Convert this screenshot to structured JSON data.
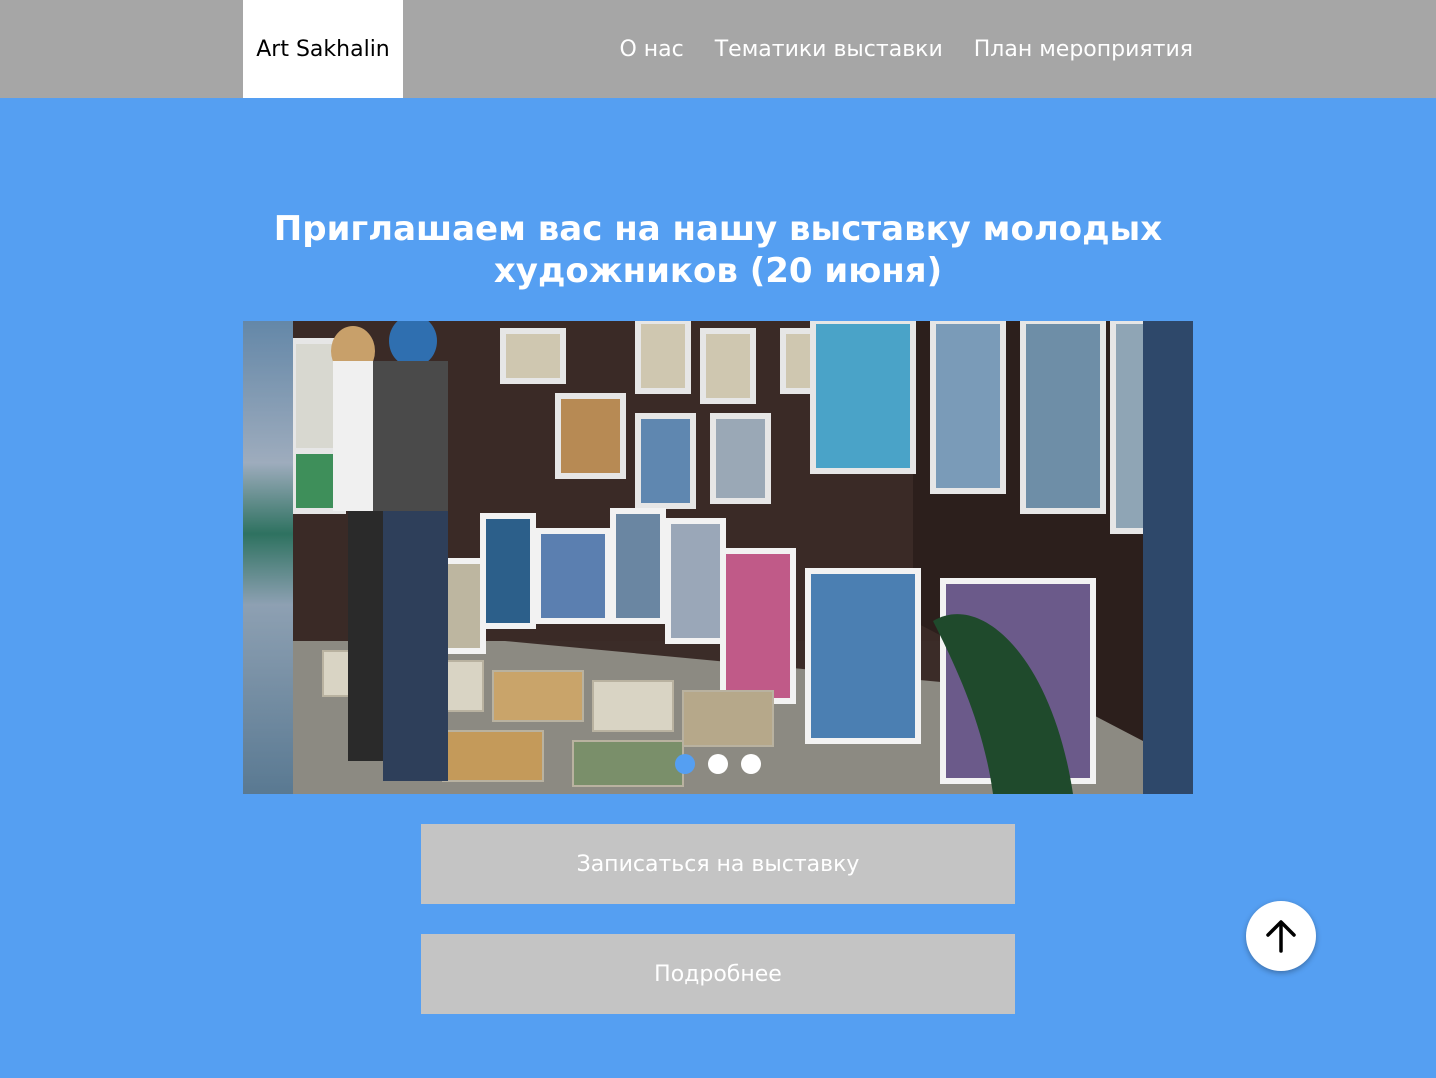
{
  "header": {
    "logo": "Art Sakhalin",
    "nav": [
      "О нас",
      "Тематики выставки",
      "План мероприятия"
    ]
  },
  "hero": {
    "title": "Приглашаем вас на нашу выставку молодых художников (20 июня)"
  },
  "slider": {
    "slide_count": 3,
    "active_slide": 1
  },
  "buttons": {
    "register": "Записаться на выставку",
    "more": "Подробнее"
  },
  "colors": {
    "page_background": "#559ff2",
    "header_background": "#a6a6a6",
    "button_background": "#c4c4c4",
    "active_dot": "#559ff2"
  },
  "icons": {
    "scroll_top": "arrow-up-icon"
  }
}
